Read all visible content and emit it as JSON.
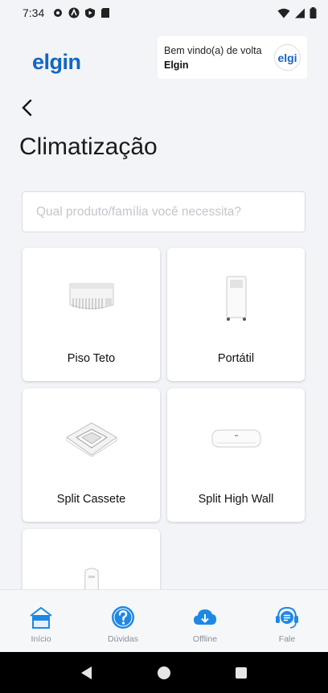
{
  "status_bar": {
    "time": "7:34"
  },
  "header": {
    "logo_text": "elgin",
    "welcome": {
      "line1": "Bem vindo(a) de volta",
      "line2": "Elgin",
      "avatar_text": "elgi"
    }
  },
  "page": {
    "title": "Climatização"
  },
  "search": {
    "placeholder": "Qual produto/família você necessita?",
    "value": ""
  },
  "products": [
    {
      "label": "Piso Teto",
      "icon": "piso-teto-ac"
    },
    {
      "label": "Portátil",
      "icon": "portable-ac"
    },
    {
      "label": "Split Cassete",
      "icon": "cassette-ac"
    },
    {
      "label": "Split High Wall",
      "icon": "high-wall-ac"
    },
    {
      "label": "",
      "icon": "tower-ac"
    }
  ],
  "bottom_nav": [
    {
      "label": "Início",
      "icon": "home-icon",
      "active": true
    },
    {
      "label": "Dúvidas",
      "icon": "question-icon",
      "active": false
    },
    {
      "label": "Offline",
      "icon": "cloud-download-icon",
      "active": false
    },
    {
      "label": "Fale",
      "icon": "support-icon",
      "active": false
    }
  ],
  "colors": {
    "brand": "#1565c0",
    "nav_icon": "#1e88e5",
    "background": "#f2f4f7"
  }
}
